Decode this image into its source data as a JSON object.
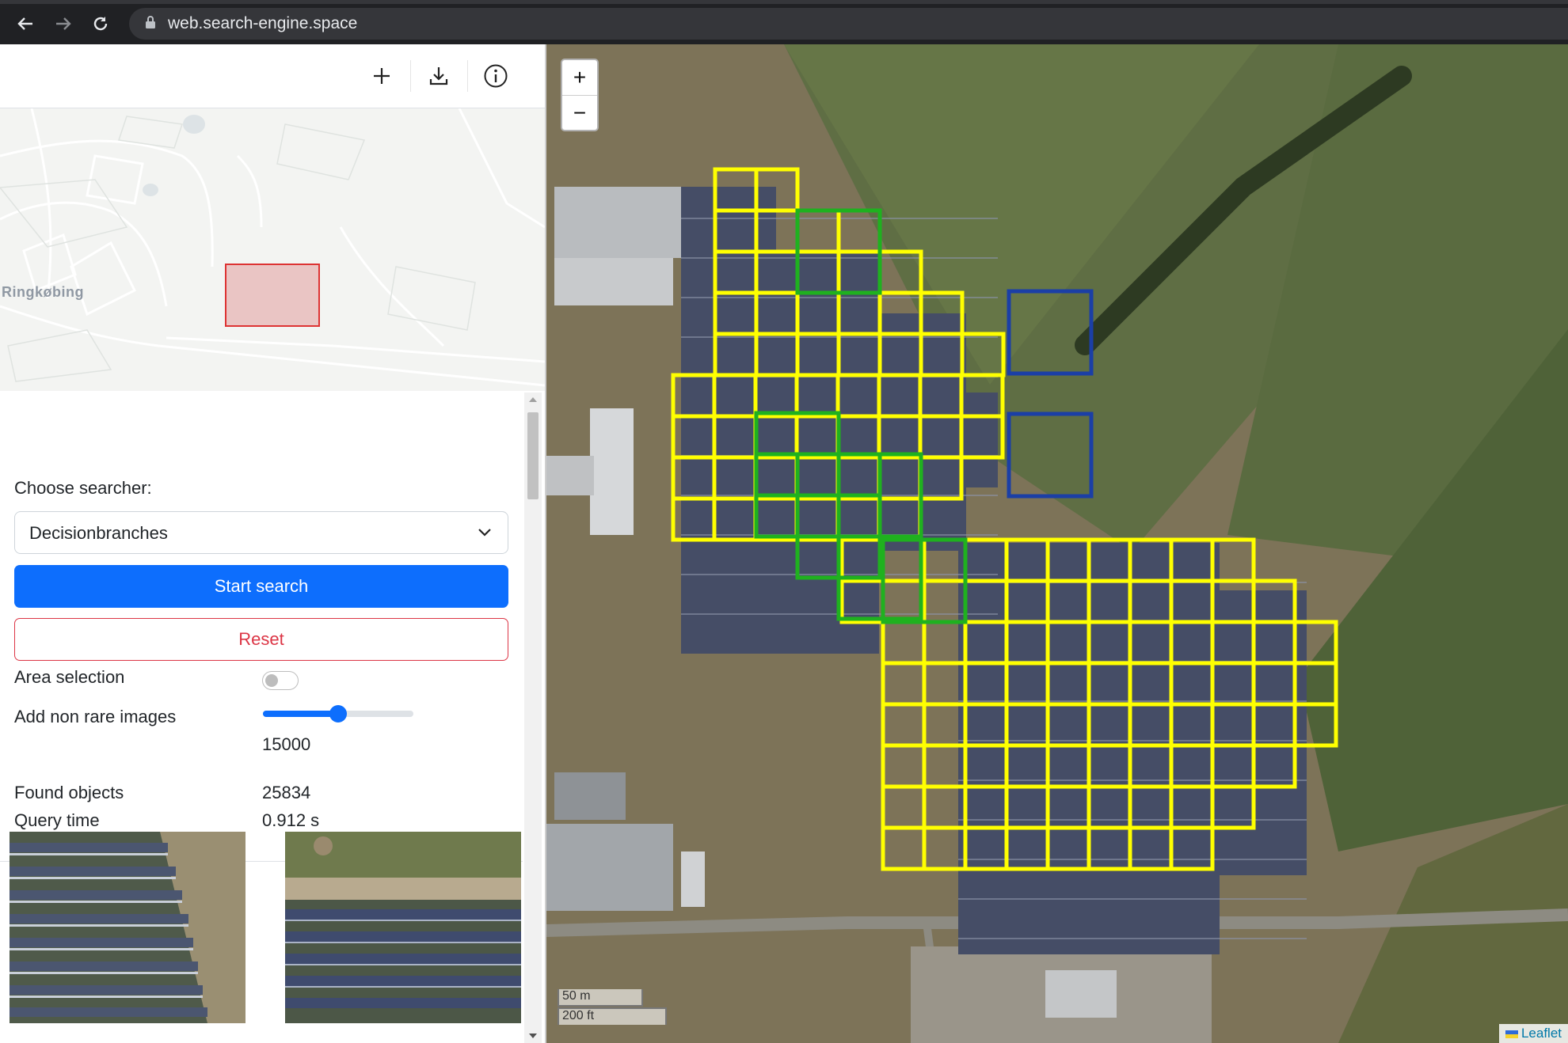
{
  "browser": {
    "url": "web.search-engine.space",
    "icons": [
      "back-arrow-icon",
      "forward-arrow-icon",
      "reload-icon",
      "lock-icon"
    ]
  },
  "toolbar": {
    "icons": [
      "plus-icon",
      "download-icon",
      "info-icon"
    ]
  },
  "minimap": {
    "place_label": "Ringkøbing"
  },
  "controls": {
    "choose_searcher_label": "Choose searcher:",
    "searcher_selected": "Decisionbranches",
    "start_search_label": "Start search",
    "reset_label": "Reset",
    "area_selection_label": "Area selection",
    "area_selection_on": false,
    "non_rare_label": "Add non rare images",
    "non_rare_value": "15000",
    "non_rare_slider_fraction": 0.5,
    "found_objects_label": "Found objects",
    "found_objects_value": "25834",
    "query_time_label": "Query time",
    "query_time_value": "0.912 s"
  },
  "map": {
    "zoom_in": "+",
    "zoom_out": "−",
    "scale_metric": "50 m",
    "scale_imperial": "200 ft",
    "attribution": "Leaflet",
    "colors": {
      "grid_yellow": "#ffff00",
      "grid_green": "#1fb11f",
      "grid_blue": "#1b3fa6",
      "accent_blue": "#0d6efd",
      "danger_red": "#dc3545"
    }
  }
}
